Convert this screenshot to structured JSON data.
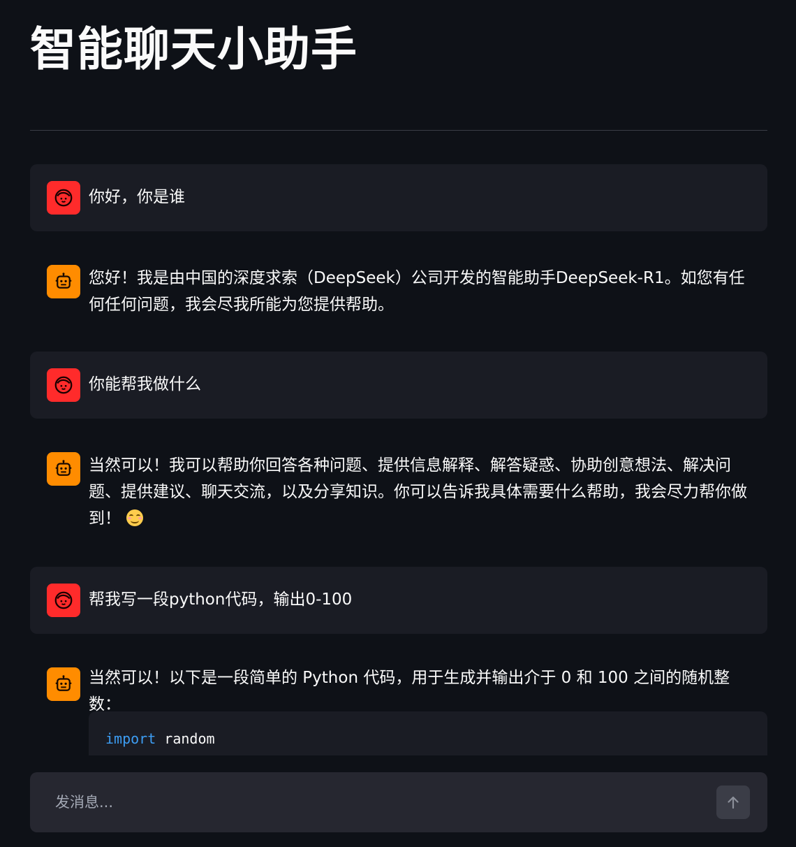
{
  "header": {
    "title": "智能聊天小助手"
  },
  "messages": [
    {
      "role": "user",
      "avatar_icon": "user-face-icon",
      "text": "你好，你是谁"
    },
    {
      "role": "assistant",
      "avatar_icon": "robot-icon",
      "text": "您好！我是由中国的深度求索（DeepSeek）公司开发的智能助手DeepSeek-R1。如您有任何任何问题，我会尽我所能为您提供帮助。"
    },
    {
      "role": "user",
      "avatar_icon": "user-face-icon",
      "text": "你能帮我做什么"
    },
    {
      "role": "assistant",
      "avatar_icon": "robot-icon",
      "text": "当然可以！我可以帮助你回答各种问题、提供信息解释、解答疑惑、协助创意想法、解决问题、提供建议、聊天交流，以及分享知识。你可以告诉我具体需要什么帮助，我会尽力帮你做到！",
      "emoji": "smiling-face-icon"
    },
    {
      "role": "user",
      "avatar_icon": "user-face-icon",
      "text": "帮我写一段python代码，输出0-100"
    },
    {
      "role": "assistant",
      "avatar_icon": "robot-icon",
      "text": "当然可以！以下是一段简单的 Python 代码，用于生成并输出介于 0 和 100 之间的随机整数：",
      "code": {
        "keyword": "import",
        "rest": " random"
      }
    }
  ],
  "input": {
    "placeholder": "发消息...",
    "value": ""
  },
  "send_button": {
    "icon": "arrow-up-icon"
  },
  "colors": {
    "background": "#0e1117",
    "user_bubble": "#1a1c24",
    "user_avatar": "#ff2b2b",
    "bot_avatar": "#ff8c00",
    "code_keyword": "#3d9df3",
    "input_bar": "#262730"
  }
}
